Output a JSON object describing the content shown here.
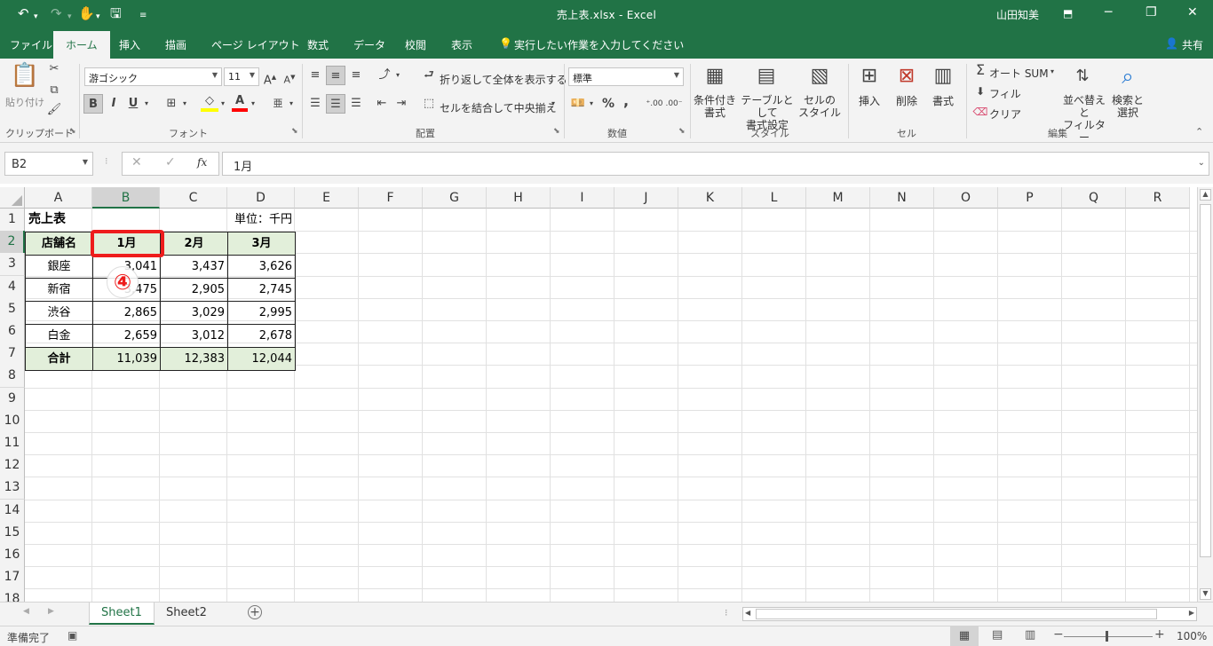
{
  "titlebar": {
    "undo_icon": "undo-icon",
    "redo_icon": "redo-icon",
    "touch_icon": "touch-mode-icon",
    "save_icon": "save-icon",
    "qat_icon": "customize-qat-icon",
    "title": "売上表.xlsx  -  Excel",
    "user": "山田知美",
    "ribbon_display_icon": "ribbon-display-options-icon",
    "minimize": "─",
    "restore": "❐",
    "close": "✕"
  },
  "tabs": [
    {
      "label": "ファイル"
    },
    {
      "label": "ホーム"
    },
    {
      "label": "挿入"
    },
    {
      "label": "描画"
    },
    {
      "label": "ページ レイアウト"
    },
    {
      "label": "数式"
    },
    {
      "label": "データ"
    },
    {
      "label": "校閲"
    },
    {
      "label": "表示"
    }
  ],
  "tell_me": "実行したい作業を入力してください",
  "share": "共有",
  "ribbon": {
    "clipboard": {
      "paste": "貼り付け",
      "group": "クリップボード"
    },
    "font": {
      "name": "游ゴシック",
      "size": "11",
      "bold": "B",
      "italic": "I",
      "underline": "U",
      "group": "フォント"
    },
    "alignment": {
      "wrap": "折り返して全体を表示する",
      "merge": "セルを結合して中央揃え",
      "group": "配置"
    },
    "number": {
      "format": "標準",
      "percent": "%",
      "comma": ",",
      "group": "数値"
    },
    "styles": {
      "conditional_1": "条件付き",
      "conditional_2": "書式",
      "table_1": "テーブルとして",
      "table_2": "書式設定",
      "cell_1": "セルの",
      "cell_2": "スタイル",
      "group": "スタイル"
    },
    "cells": {
      "insert": "挿入",
      "delete": "削除",
      "format": "書式",
      "group": "セル"
    },
    "editing": {
      "autosum": "オート SUM",
      "fill": "フィル",
      "clear": "クリア",
      "sort_1": "並べ替えと",
      "sort_2": "フィルター",
      "find_1": "検索と",
      "find_2": "選択",
      "group": "編集"
    }
  },
  "formula_bar": {
    "name_box": "B2",
    "fx": "fx",
    "value": "1月"
  },
  "columns": [
    "A",
    "B",
    "C",
    "D",
    "E",
    "F",
    "G",
    "H",
    "I",
    "J",
    "K",
    "L",
    "M",
    "N",
    "O",
    "P",
    "Q",
    "R"
  ],
  "rows": [
    "1",
    "2",
    "3",
    "4",
    "5",
    "6",
    "7",
    "8",
    "9",
    "10",
    "11",
    "12",
    "13",
    "14",
    "15",
    "16",
    "17",
    "18"
  ],
  "sheet": {
    "title": "売上表",
    "unit": "単位：千円",
    "header": [
      "店舗名",
      "1月",
      "2月",
      "3月"
    ],
    "data": [
      [
        "銀座",
        "3,041",
        "3,437",
        "3,626"
      ],
      [
        "新宿",
        "3,475",
        "2,905",
        "2,745"
      ],
      [
        "渋谷",
        "2,865",
        "3,029",
        "2,995"
      ],
      [
        "白金",
        "2,659",
        "3,012",
        "2,678"
      ]
    ],
    "total": [
      "合計",
      "11,039",
      "12,383",
      "12,044"
    ]
  },
  "annotation": "④",
  "sheet_tabs": [
    "Sheet1",
    "Sheet2"
  ],
  "status": {
    "ready": "準備完了",
    "zoom": "100%"
  },
  "colors": {
    "excel_green": "#217346",
    "table_header_fill": "#e2efda",
    "highlight_red": "#ee1c1c"
  }
}
